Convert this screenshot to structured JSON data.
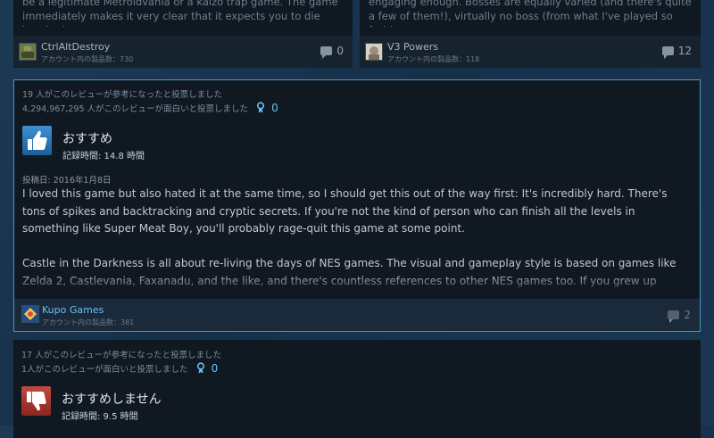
{
  "top_cards": [
    {
      "snippet": "be a legitimate Metroidvania or a kaizo trap game. The game immediately makes it very clear that it expects you to die hundreds",
      "author": "CtrlAltDestroy",
      "games": "アカウント内の製品数：730",
      "comments": "0"
    },
    {
      "snippet": "engaging enough. Bosses are equally varied (and there's quite a few of them!), virtually no boss (from what I've played so far) is",
      "author": "V3 Powers",
      "games": "アカウント内の製品数：118",
      "comments": "12"
    }
  ],
  "review_1": {
    "helpful": "19 人がこのレビューが参考になったと投票しました",
    "funny": "4,294,967,295 人がこのレビューが面白いと投票しました",
    "award_count": "0",
    "recommendation": "おすすめ",
    "hours": "記録時間: 14.8 時間",
    "posted": "投稿日: 2016年1月8日",
    "paragraphs": [
      "I loved this game but also hated it at the same time, so I should get this out of the way first: It's incredibly hard. There's tons of spikes and backtracking and cryptic secrets. If you're not the kind of person who can finish all the levels in something like Super Meat Boy, you'll probably rage-quit this game at some point.",
      "Castle in the Darkness is all about re-living the days of NES games. The visual and gameplay style is based on games like Zelda 2, Castlevania, Faxanadu, and the like, and there's countless references to other NES games too. If you grew up playing those games, you'll get"
    ],
    "author": "Kupo Games",
    "games": "アカウント内の製品数：381",
    "comments": "2",
    "accent": "#66c0f4"
  },
  "review_2": {
    "helpful": "17 人がこのレビューが参考になったと投票しました",
    "funny": "1人がこのレビューが面白いと投票しました",
    "award_count": "0",
    "recommendation": "おすすめしません",
    "hours": "記録時間: 9.5 時間"
  },
  "icons": {
    "positive": "thumbs-up-icon",
    "negative": "thumbs-down-icon",
    "award": "award-icon",
    "comment": "comment-bubble-icon"
  }
}
